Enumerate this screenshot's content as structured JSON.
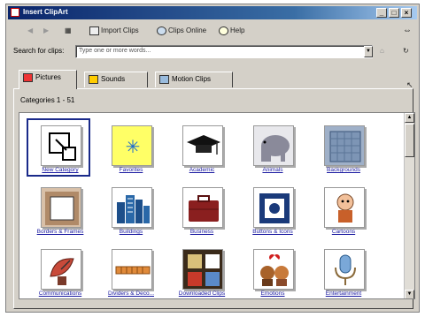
{
  "window": {
    "title": "Insert ClipArt"
  },
  "toolbar": {
    "import_label": "Import Clips",
    "online_label": "Clips Online",
    "help_label": "Help"
  },
  "search": {
    "label": "Search for clips:",
    "value": "Type one or more words..."
  },
  "tabs": [
    {
      "label": "Pictures",
      "icon": "pictures-icon"
    },
    {
      "label": "Sounds",
      "icon": "sounds-icon"
    },
    {
      "label": "Motion Clips",
      "icon": "motion-clips-icon"
    }
  ],
  "categories_label": "Categories 1 - 51",
  "categories": [
    {
      "label": "New Category",
      "icon": "new-category-icon"
    },
    {
      "label": "Favorites",
      "icon": "favorites-icon"
    },
    {
      "label": "Academic",
      "icon": "graduation-cap-icon"
    },
    {
      "label": "Animals",
      "icon": "elephant-icon"
    },
    {
      "label": "Backgrounds",
      "icon": "background-pattern-icon"
    },
    {
      "label": "Borders & Frames",
      "icon": "frame-icon"
    },
    {
      "label": "Buildings",
      "icon": "buildings-icon"
    },
    {
      "label": "Business",
      "icon": "briefcase-icon"
    },
    {
      "label": "Buttons & Icons",
      "icon": "button-icon"
    },
    {
      "label": "Cartoons",
      "icon": "cartoon-icon"
    },
    {
      "label": "Communications",
      "icon": "satellite-dish-icon"
    },
    {
      "label": "Dividers & Deco...",
      "icon": "divider-icon"
    },
    {
      "label": "Downloaded Clips",
      "icon": "downloaded-clips-icon"
    },
    {
      "label": "Emotions",
      "icon": "emotions-icon"
    },
    {
      "label": "Entertainment",
      "icon": "microphone-icon"
    }
  ]
}
